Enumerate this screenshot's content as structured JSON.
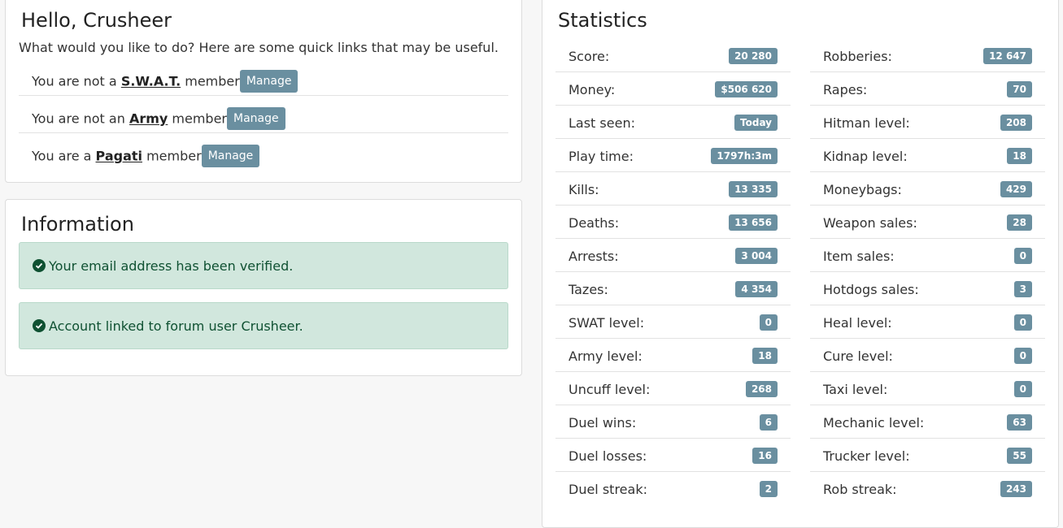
{
  "hello": {
    "title": "Hello, Crusheer",
    "intro": "What would you like to do? Here are some quick links that may be useful.",
    "memberships": [
      {
        "prefix": "You are not a ",
        "group": "S.W.A.T.",
        "suffix": " member",
        "button": "Manage"
      },
      {
        "prefix": "You are not an ",
        "group": "Army",
        "suffix": " member",
        "button": "Manage"
      },
      {
        "prefix": "You are a ",
        "group": "Pagati",
        "suffix": " member",
        "button": "Manage"
      }
    ]
  },
  "info": {
    "title": "Information",
    "alerts": [
      {
        "text": "Your email address has been verified.",
        "icon": "check-circle-icon"
      },
      {
        "text": "Account linked to forum user Crusheer.",
        "icon": "check-circle-icon"
      }
    ]
  },
  "stats": {
    "title": "Statistics",
    "left": [
      {
        "label": "Score:",
        "value": "20 280"
      },
      {
        "label": "Money:",
        "value": "$506 620"
      },
      {
        "label": "Last seen:",
        "value": "Today"
      },
      {
        "label": "Play time:",
        "value": "1797h:3m"
      },
      {
        "label": "Kills:",
        "value": "13 335"
      },
      {
        "label": "Deaths:",
        "value": "13 656"
      },
      {
        "label": "Arrests:",
        "value": "3 004"
      },
      {
        "label": "Tazes:",
        "value": "4 354"
      },
      {
        "label": "SWAT level:",
        "value": "0"
      },
      {
        "label": "Army level:",
        "value": "18"
      },
      {
        "label": "Uncuff level:",
        "value": "268"
      },
      {
        "label": "Duel wins:",
        "value": "6"
      },
      {
        "label": "Duel losses:",
        "value": "16"
      },
      {
        "label": "Duel streak:",
        "value": "2"
      }
    ],
    "right": [
      {
        "label": "Robberies:",
        "value": "12 647"
      },
      {
        "label": "Rapes:",
        "value": "70"
      },
      {
        "label": "Hitman level:",
        "value": "208"
      },
      {
        "label": "Kidnap level:",
        "value": "18"
      },
      {
        "label": "Moneybags:",
        "value": "429"
      },
      {
        "label": "Weapon sales:",
        "value": "28"
      },
      {
        "label": "Item sales:",
        "value": "0"
      },
      {
        "label": "Hotdogs sales:",
        "value": "3"
      },
      {
        "label": "Heal level:",
        "value": "0"
      },
      {
        "label": "Cure level:",
        "value": "0"
      },
      {
        "label": "Taxi level:",
        "value": "0"
      },
      {
        "label": "Mechanic level:",
        "value": "63"
      },
      {
        "label": "Trucker level:",
        "value": "55"
      },
      {
        "label": "Rob streak:",
        "value": "243"
      }
    ]
  },
  "colors": {
    "badge": "#6a8fa0",
    "alert_bg": "#d1e7dd",
    "alert_text": "#0f5132"
  }
}
